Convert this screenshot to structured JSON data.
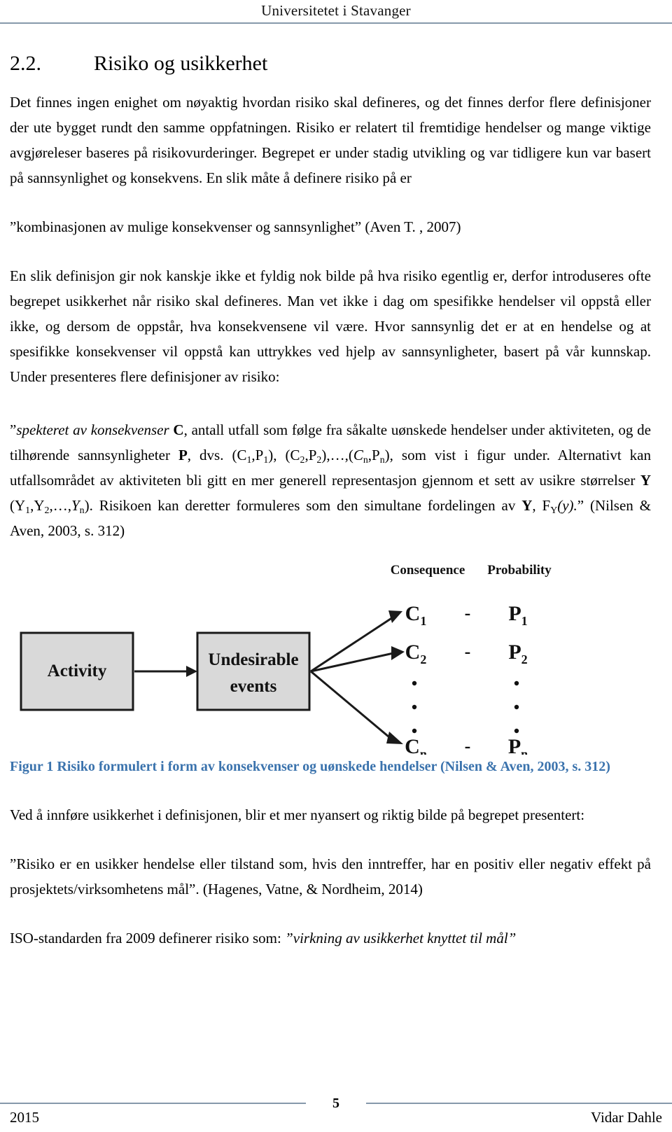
{
  "header": {
    "title": "Universitetet i Stavanger",
    "rule_color": "#8699ab"
  },
  "section": {
    "number": "2.2.",
    "title": "Risiko og usikkerhet"
  },
  "paragraphs": {
    "intro": "Det finnes ingen enighet om nøyaktig hvordan risiko skal defineres, og det finnes derfor flere definisjoner der ute bygget rundt den samme oppfatningen. Risiko er relatert til fremtidige hendelser og mange viktige avgjøreleser baseres på risikovurderinger. Begrepet er under stadig utvikling og var tidligere kun var basert på sannsynlighet og konsekvens. En slik måte å definere risiko på er",
    "quote_aven": "”kombinasjonen av mulige konsekvenser og sannsynlighet” (Aven T. , 2007)",
    "uncertainty": "En slik definisjon gir nok kanskje ikke et fyldig nok bilde på hva risiko egentlig er, derfor introduseres ofte begrepet usikkerhet når risiko skal defineres. Man vet ikke i dag om spesifikke hendelser vil oppstå eller ikke, og dersom de oppstår, hva konsekvensene vil være. Hvor sannsynlig det er at en hendelse og at spesifikke konsekvenser vil oppstå kan uttrykkes ved hjelp av sannsynligheter, basert på vår kunnskap. Under presenteres flere definisjoner av risiko:",
    "nilsen_aven": {
      "open_quote": "”",
      "italic_lead": "spekteret av konsekvenser",
      "bold_c": "C",
      "seg1": ", antall utfall som følge fra såkalte uønskede hendelser under aktiviteten, og de tilhørende sannsynligheter ",
      "bold_p": "P",
      "seg2": ", dvs. (C",
      "sub1a": "1",
      "seg3": ",P",
      "sub1b": "1",
      "seg4": "), (C",
      "sub2a": "2",
      "seg5": ",P",
      "sub2b": "2",
      "seg6": "),…,(",
      "italic_cn": "C",
      "sub_n_a": "n",
      "seg7": ",P",
      "sub_n_b": "n",
      "seg8": "), som vist i figur under. Alternativt kan utfallsområdet av aktiviteten bli gitt en mer generell representasjon gjennom et sett av usikre størrelser ",
      "bold_y": "Y",
      "seg9": " (Y",
      "suby1": "1",
      "seg10": ",Y",
      "suby2": "2",
      "seg11": ",…,",
      "italic_yn": "Y",
      "suby_n": "n",
      "seg12": "). Risikoen kan deretter formuleres som den simultane fordelingen av ",
      "bold_y2": "Y",
      "seg13": ", F",
      "sub_big_y": "Y",
      "italic_of_y": "(y).",
      "close_quote": "”",
      "citation": " (Nilsen & Aven, 2003, s. 312)"
    },
    "after_figure": "Ved å innføre usikkerhet i definisjonen, blir et mer nyansert og riktig bilde på begrepet presentert:",
    "quote_hagenes_open": "”Risiko er en usikker hendelse eller tilstand som, hvis den inntreffer, har en positiv eller negativ effekt på prosjektets/virksomhetens mål”",
    "quote_hagenes_cite": ". (Hagenes, Vatne, & Nordheim, 2014)",
    "iso_lead": "ISO-standarden fra 2009 definerer risiko som: ",
    "iso_quote": "”virkning av usikkerhet knyttet til mål”"
  },
  "figure": {
    "caption": "Figur 1 Risiko formulert i form av konsekvenser og uønskede hendelser (Nilsen & Aven, 2003, s. 312)",
    "caption_color": "#3b73ad",
    "box_fill": "#d9d9d9",
    "box_stroke": "#1a1a1a",
    "box_activity_label": "Activity",
    "box_events_line1": "Undesirable",
    "box_events_line2": "events",
    "col_header_consequence": "Consequence",
    "col_header_probability": "Probability",
    "dash": "-",
    "rows": [
      {
        "consequence": "C",
        "consequence_sub": "1",
        "probability": "P",
        "probability_sub": "1"
      },
      {
        "consequence": "C",
        "consequence_sub": "2",
        "probability": "P",
        "probability_sub": "2"
      },
      {
        "consequence": "C",
        "consequence_sub": "n",
        "probability": "P",
        "probability_sub": "n"
      }
    ],
    "ellipsis_dot": "•"
  },
  "footer": {
    "year": "2015",
    "page_number": "5",
    "author": "Vidar Dahle",
    "rule_color": "#8699ab"
  }
}
